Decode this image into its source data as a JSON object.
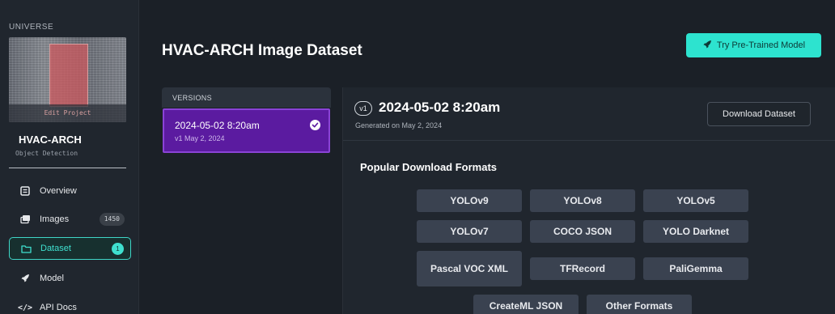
{
  "sidebar": {
    "brand": "UNIVERSE",
    "thumbnail_edit_label": "Edit Project",
    "project_name": "HVAC-ARCH",
    "project_type": "Object Detection",
    "nav": {
      "overview": "Overview",
      "images": "Images",
      "images_count": "1450",
      "dataset": "Dataset",
      "dataset_count": "1",
      "model": "Model",
      "api_docs": "API Docs"
    }
  },
  "header": {
    "title": "HVAC-ARCH Image Dataset",
    "try_button": "Try Pre-Trained Model"
  },
  "versions": {
    "heading": "VERSIONS",
    "items": [
      {
        "title": "2024-05-02 8:20am",
        "subtitle": "v1 May 2, 2024"
      }
    ]
  },
  "version_detail": {
    "badge": "v1",
    "title": "2024-05-02 8:20am",
    "generated": "Generated on May 2, 2024",
    "download_button": "Download Dataset",
    "formats_title": "Popular Download Formats",
    "formats": [
      "YOLOv9",
      "YOLOv8",
      "YOLOv5",
      "YOLOv7",
      "COCO JSON",
      "YOLO Darknet",
      "Pascal VOC XML",
      "TFRecord",
      "PaliGemma",
      "CreateML JSON",
      "Other Formats"
    ]
  },
  "colors": {
    "accent": "#2de3cf",
    "version_selected": "#5b1ba0",
    "background": "#1b2027"
  }
}
